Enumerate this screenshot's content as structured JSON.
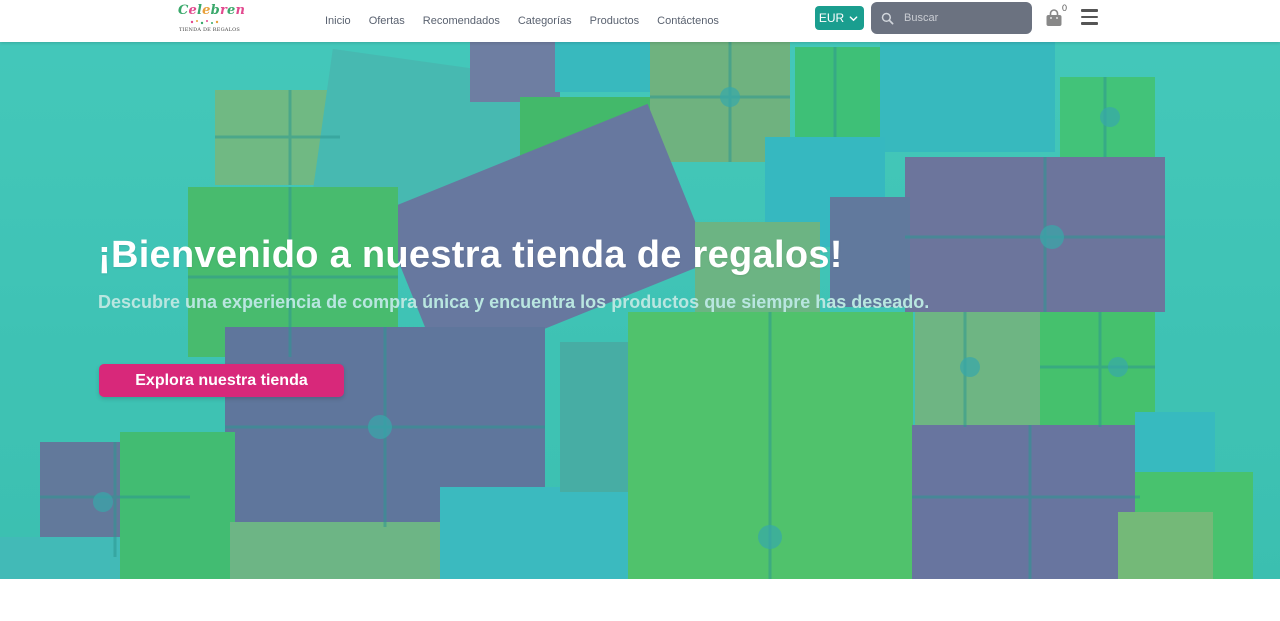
{
  "brand": {
    "logo_text": "Celebren",
    "logo_subtext": "TIENDA DE REGALOS",
    "colors": {
      "teal": "#1a9e8f",
      "pink": "#d8287a",
      "logo_pink": "#e24a8f",
      "logo_green": "#3aa86b"
    }
  },
  "nav": {
    "links": [
      "Inicio",
      "Ofertas",
      "Recomendados",
      "Categorías",
      "Productos",
      "Contáctenos"
    ]
  },
  "toolbar": {
    "currency": "EUR",
    "search_placeholder": "Buscar",
    "cart_count": "0",
    "icons": [
      "chevron-down-icon",
      "search-icon",
      "shopping-bag-icon",
      "hamburger-menu-icon"
    ]
  },
  "hero": {
    "title": "¡Bienvenido a nuestra tienda de regalos!",
    "subtitle": "Descubre una experiencia de compra única y encuentra los productos que siempre has deseado.",
    "cta_label": "Explora nuestra tienda",
    "overlay_color": "#2ec4b6"
  }
}
